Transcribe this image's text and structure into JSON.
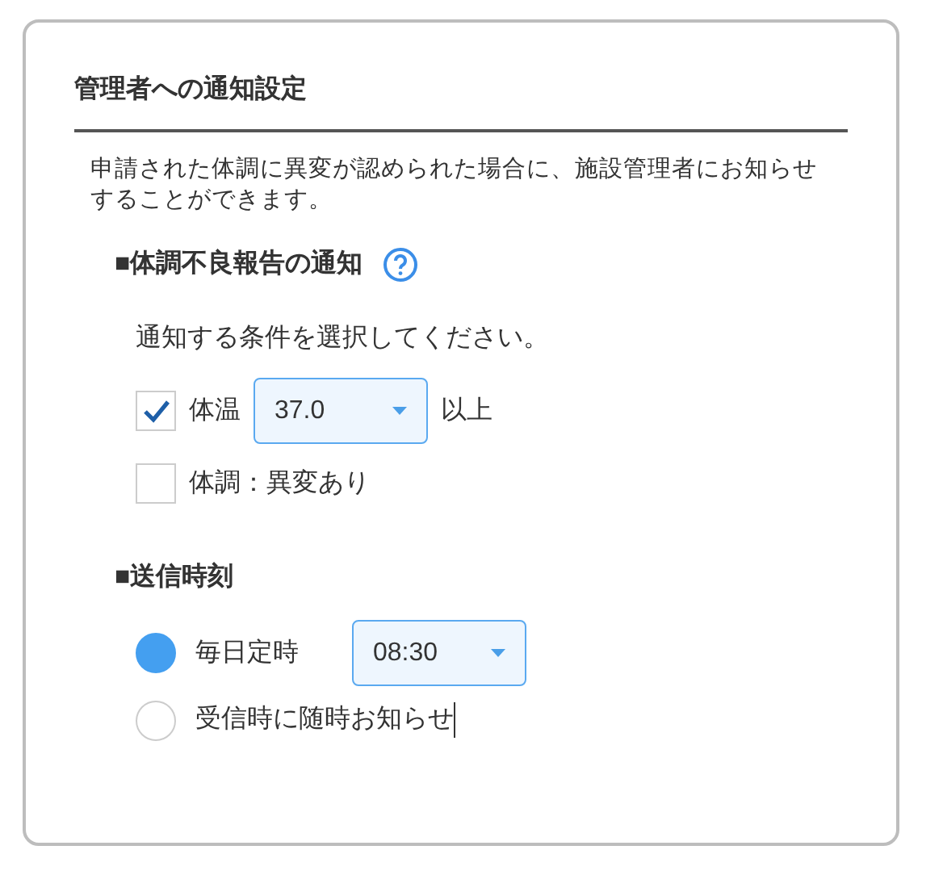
{
  "title": "管理者への通知設定",
  "description": "申請された体調に異変が認められた場合に、施設管理者にお知らせすることができます。",
  "report_section": {
    "heading": "■体調不良報告の通知",
    "instruction": "通知する条件を選択してください。",
    "conditions": [
      {
        "kind": "threshold",
        "label": "体温",
        "checked": true,
        "value": "37.0",
        "suffix": "以上"
      },
      {
        "kind": "plain",
        "label": "体調：異変あり",
        "checked": false
      }
    ]
  },
  "timing_section": {
    "heading": "■送信時刻",
    "options": [
      {
        "kind": "time",
        "label": "毎日定時",
        "selected": true,
        "value": "08:30"
      },
      {
        "kind": "plain",
        "label": "受信時に随時お知らせ",
        "selected": false,
        "focused": true
      }
    ]
  }
}
